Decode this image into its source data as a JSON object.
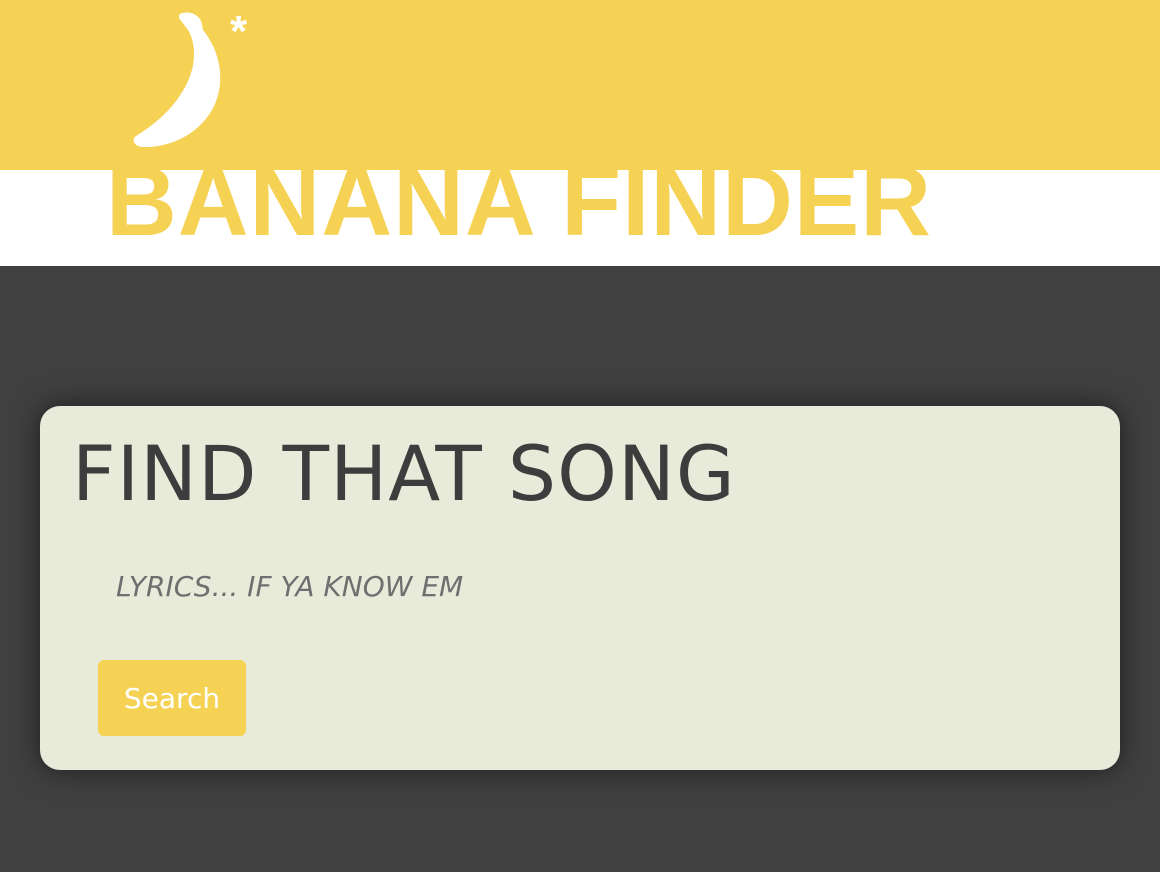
{
  "header": {
    "brand_title": "BANANA FINDER",
    "logo_icon": "banana-icon",
    "logo_mark": "*"
  },
  "search": {
    "heading": "FIND THAT SONG",
    "lyrics_placeholder": "LYRICS... IF YA KNOW EM",
    "lyrics_value": "",
    "button_label": "Search"
  },
  "colors": {
    "brand_yellow": "#f6d254",
    "page_background": "#404040",
    "card_background": "#e9ebda",
    "heading_text": "#3d3d3d",
    "placeholder_text": "#6f6f6f"
  }
}
